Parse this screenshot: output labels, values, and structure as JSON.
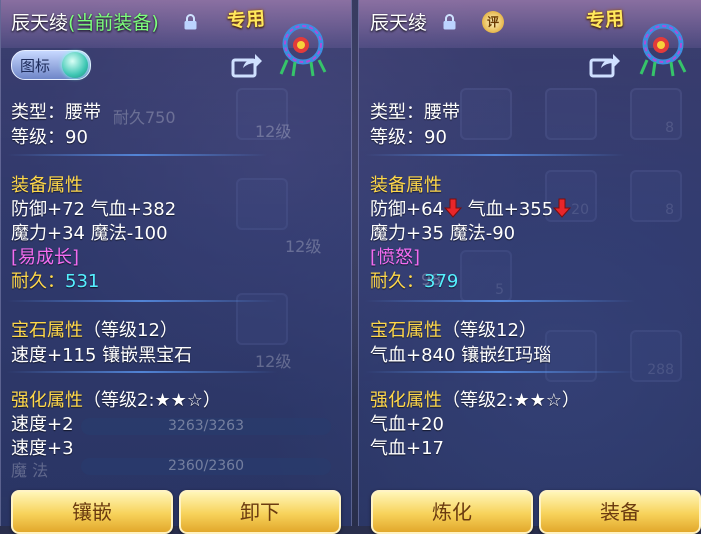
{
  "left": {
    "name": "辰天绫",
    "name_suffix": "(当前装备)",
    "zhuanyong": "专用",
    "toggle_label": "图标",
    "type_line": "类型：腰带",
    "level_line": "等级：90",
    "equip_header": "装备属性",
    "attr1": "防御+72 气血+382",
    "attr2": "魔力+34 魔法-100",
    "special": "[易成长]",
    "durability_label": "耐久：",
    "durability_value": "531",
    "gem_header": "宝石属性",
    "gem_level": "（等级12）",
    "gem_line": "速度+115 镶嵌黑宝石",
    "enh_header": "强化属性",
    "enh_level": "（等级2:★★☆）",
    "enh1": "速度+2",
    "enh2": "速度+3",
    "btn1": "镶嵌",
    "btn2": "卸下",
    "ghost_bar1": "3263/3263",
    "ghost_bar2": "2360/2360",
    "ghost_label": "魔 法",
    "ghost_durability": "耐久750",
    "ghost_level1": "12级",
    "ghost_level2": "12级",
    "ghost_level3": "12级"
  },
  "right": {
    "name": "辰天绫",
    "ping": "评",
    "zhuanyong": "专用",
    "type_line": "类型：腰带",
    "level_line": "等级：90",
    "equip_header": "装备属性",
    "attr1a": "防御+64",
    "attr1b": "气血+355",
    "attr2": "魔力+35 魔法-90",
    "special": "[愤怒]",
    "durability_label": "耐久：",
    "durability_value": "379",
    "gem_header": "宝石属性",
    "gem_level": "（等级12）",
    "gem_line": "气血+840 镶嵌红玛瑙",
    "enh_header": "强化属性",
    "enh_level": "（等级2:★★☆）",
    "enh1": "气血+20",
    "enh2": "气血+17",
    "btn1": "炼化",
    "btn2": "装备",
    "ghost_nums": [
      "8",
      "8",
      "20",
      "98",
      "5",
      "288"
    ]
  },
  "colors": {
    "section": "#ffd84a",
    "special": "#f36cf0",
    "durability": "#55f0ff",
    "current": "#7dff7d",
    "down_arrow": "#e8262a"
  }
}
